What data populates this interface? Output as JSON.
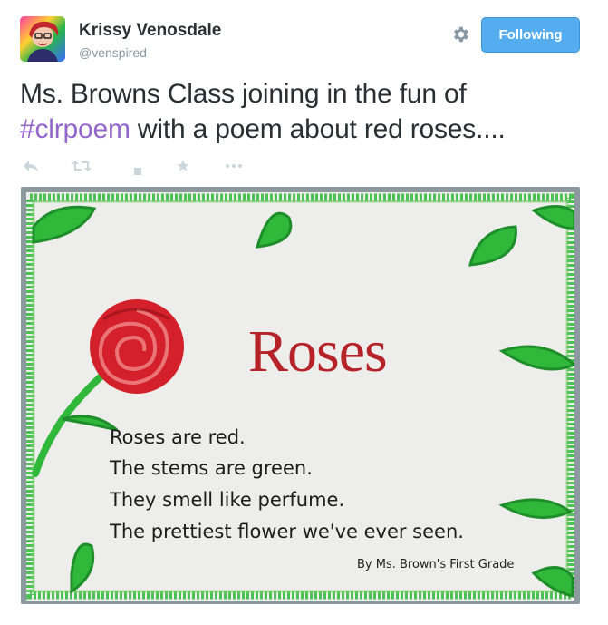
{
  "user": {
    "name": "Krissy Venosdale",
    "handle": "@venspired"
  },
  "follow_button": {
    "label": "Following"
  },
  "tweet": {
    "text_before": "Ms. Browns Class joining in the fun of ",
    "hashtag": "#clrpoem",
    "text_after": " with a poem about red roses...."
  },
  "actions": [
    {
      "name": "reply-icon"
    },
    {
      "name": "retweet-icon"
    },
    {
      "name": "count-dot-icon"
    },
    {
      "name": "favorite-star-icon"
    },
    {
      "name": "more-dots-icon"
    }
  ],
  "media": {
    "title": "Roses",
    "lines": [
      "Roses are red.",
      "The stems are green.",
      "They smell like perfume.",
      "The prettiest flower we've ever seen."
    ],
    "byline": "By Ms. Brown's First Grade"
  },
  "colors": {
    "follow_blue": "#55acee",
    "hashtag_purple": "#9266cc",
    "rose_red": "#d4202a",
    "leaf_green": "#2fb83a",
    "title_red": "#b52228"
  }
}
